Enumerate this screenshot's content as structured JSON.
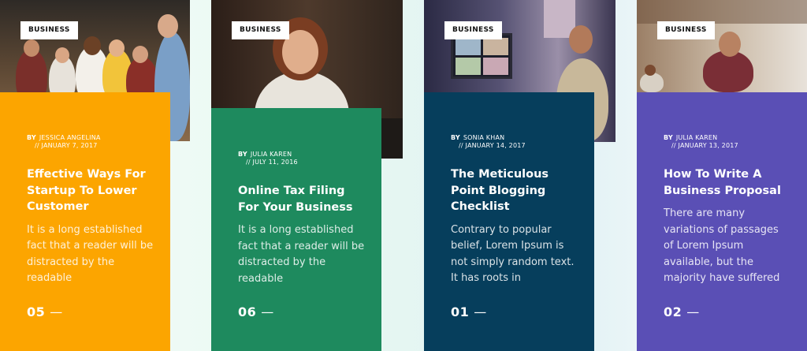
{
  "cards": [
    {
      "badge": "BUSINESS",
      "by": "BY",
      "author": "JESSICA ANGELINA",
      "date": "//  JANUARY 7, 2017",
      "title": "Effective Ways For Startup To Lower Customer",
      "excerpt": "It is a long established fact that a reader will be distracted by the readable",
      "number": "05",
      "dash": "—",
      "color": "#fca500"
    },
    {
      "badge": "BUSINESS",
      "by": "BY",
      "author": "JULIA KAREN",
      "date": "//  JULY 11, 2016",
      "title": "Online Tax Filing For Your Business",
      "excerpt": "It is a long established fact that a reader will be distracted by the readable",
      "number": "06",
      "dash": "—",
      "color": "#1e8a5e"
    },
    {
      "badge": "BUSINESS",
      "by": "BY",
      "author": "SONIA KHAN",
      "date": "//  JANUARY 14, 2017",
      "title": "The Meticulous Point Blogging Checklist",
      "excerpt": "Contrary to popular belief, Lorem Ipsum is not simply random text. It has roots in",
      "number": "01",
      "dash": "—",
      "color": "#063e5c"
    },
    {
      "badge": "BUSINESS",
      "by": "BY",
      "author": "JULIA KAREN",
      "date": "//  JANUARY 13, 2017",
      "title": "How To Write A Business Proposal",
      "excerpt": "There are many variations of passages of Lorem Ipsum available, but the majority have suffered",
      "number": "02",
      "dash": "—",
      "color": "#5a4fb5"
    }
  ]
}
